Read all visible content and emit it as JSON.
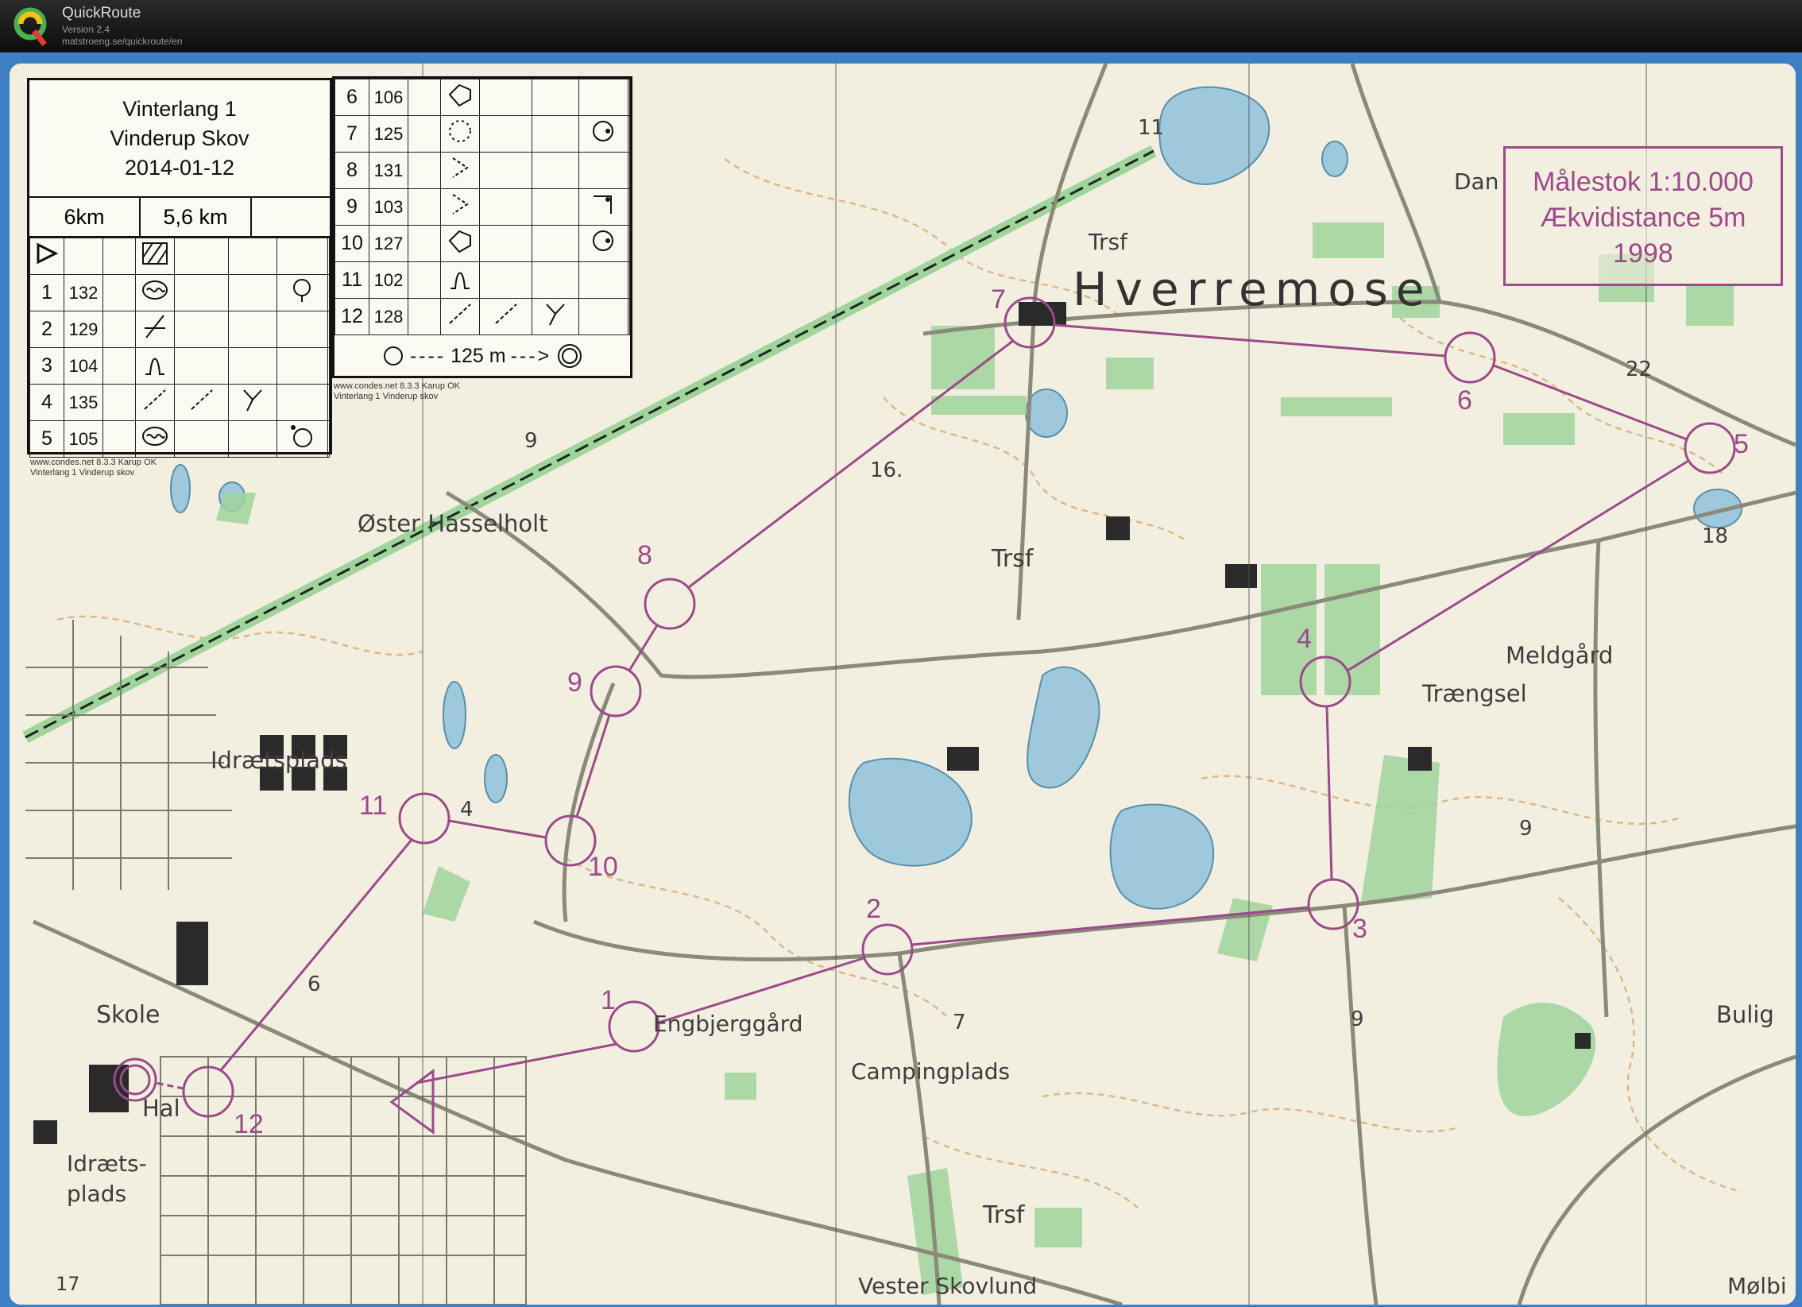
{
  "app": {
    "name": "QuickRoute",
    "version": "Version 2.4",
    "url": "matstroeng.se/quickroute/en"
  },
  "colors": {
    "course": "#9b4a8a",
    "frame": "#3e7fc4",
    "paper": "#f3efe0",
    "vegetation": "#9fd49a",
    "water": "#9ec9dd",
    "contour": "#d9b98a"
  },
  "description_sheet": {
    "title_lines": [
      "Vinterlang 1",
      "Vinderup Skov",
      "2014-01-12"
    ],
    "lengths": [
      "6km",
      "5,6 km"
    ],
    "controls_left": [
      {
        "num": "1",
        "code": "132"
      },
      {
        "num": "2",
        "code": "129"
      },
      {
        "num": "3",
        "code": "104"
      },
      {
        "num": "4",
        "code": "135"
      },
      {
        "num": "5",
        "code": "105"
      }
    ],
    "controls_right": [
      {
        "num": "6",
        "code": "106"
      },
      {
        "num": "7",
        "code": "125"
      },
      {
        "num": "8",
        "code": "131"
      },
      {
        "num": "9",
        "code": "103"
      },
      {
        "num": "10",
        "code": "127"
      },
      {
        "num": "11",
        "code": "102"
      },
      {
        "num": "12",
        "code": "128"
      }
    ],
    "finish_line": "125 m",
    "credit_left": [
      "www.condes.net 8.3.3 Karup OK",
      "Vinterlang 1 Vinderup skov"
    ],
    "credit_right": [
      "www.condes.net 8.3.3 Karup OK",
      "Vinterlang 1 Vinderup skov"
    ]
  },
  "scale_box": {
    "lines": [
      "Målestok 1:10.000",
      "Ækvidistance 5m",
      "1998"
    ]
  },
  "place_names": {
    "hverremose": "Hverremose",
    "oster_hasselholt": "Øster Hasselholt",
    "idraetsplads": "Idrætsplads",
    "skole": "Skole",
    "hal": "Hal",
    "idraetsplads_2": "Idræts-",
    "idraetsplads_3": "plads",
    "engbjerggard": "Engbjerggård",
    "campingplads": "Campingplads",
    "meldgard": "Meldgård",
    "traengsel": "Trængsel",
    "bulig": "Bulig",
    "vester_skovlund": "Vester Skovlund",
    "molbi": "Mølbi",
    "trsf_1": "Trsf",
    "trsf_2": "Trsf",
    "trsf_3": "Trsf",
    "dan": "Dan",
    "n11": "11",
    "n16": "16.",
    "n22": "22",
    "n18": "18",
    "n9a": "9",
    "n9b": "9",
    "n9c": "9",
    "n6": "6",
    "n4": "4",
    "n7": "7",
    "n17": "17"
  },
  "course_numbers": [
    "1",
    "2",
    "3",
    "4",
    "5",
    "6",
    "7",
    "8",
    "9",
    "10",
    "11",
    "12"
  ]
}
